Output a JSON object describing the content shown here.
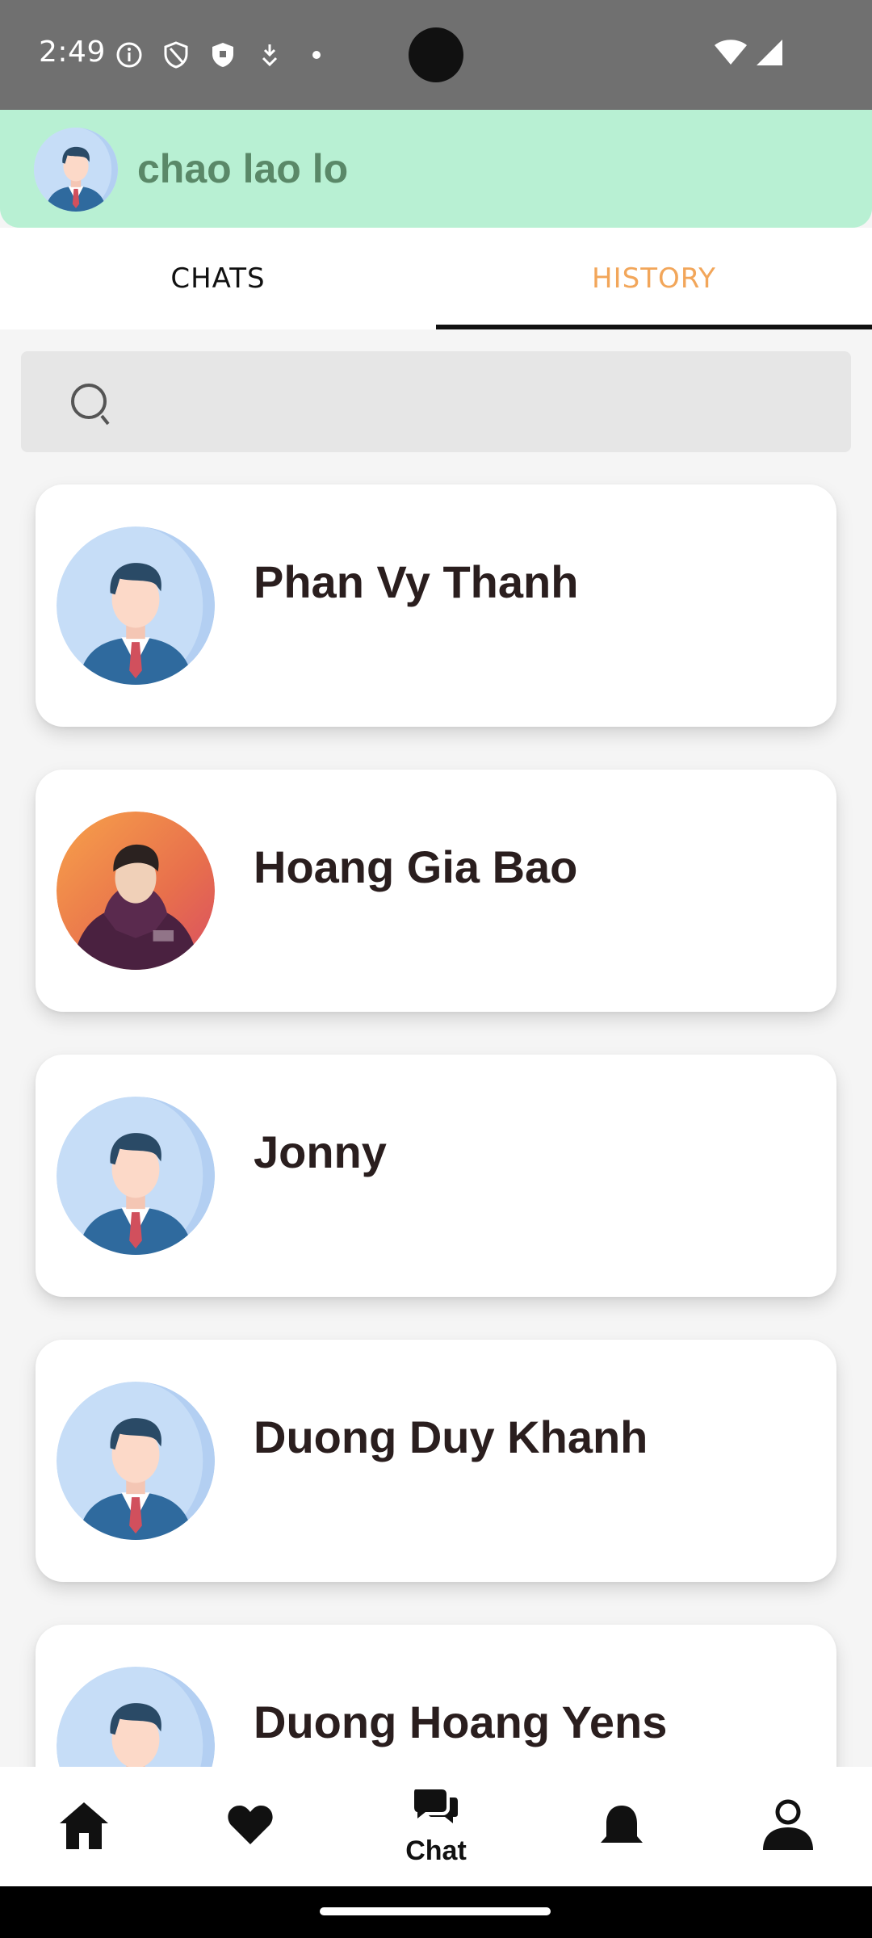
{
  "status_bar": {
    "time": "2:49",
    "left_icons": [
      "info-icon",
      "shield-outline-icon",
      "shield-filled-icon",
      "download-icon",
      "dot-icon"
    ],
    "right_icons": [
      "wifi-icon",
      "signal-icon"
    ]
  },
  "header": {
    "user_name": "chao lao lo",
    "background_color": "#b8f0d3"
  },
  "tabs": [
    {
      "label": "CHATS",
      "active": false
    },
    {
      "label": "HISTORY",
      "active": true
    }
  ],
  "search": {
    "placeholder": "",
    "value": ""
  },
  "contacts": [
    {
      "name": "Phan Vy Thanh",
      "avatar": "default-avatar"
    },
    {
      "name": "Hoang Gia Bao",
      "avatar": "photo-avatar"
    },
    {
      "name": "Jonny",
      "avatar": "default-avatar"
    },
    {
      "name": "Duong Duy Khanh",
      "avatar": "default-avatar"
    },
    {
      "name": "Duong Hoang Yens",
      "avatar": "default-avatar"
    }
  ],
  "bottom_nav": {
    "items": [
      {
        "icon": "home-icon",
        "label": ""
      },
      {
        "icon": "heart-icon",
        "label": ""
      },
      {
        "icon": "chat-icon",
        "label": "Chat"
      },
      {
        "icon": "bell-icon",
        "label": ""
      },
      {
        "icon": "person-icon",
        "label": ""
      }
    ]
  },
  "colors": {
    "accent_tab": "#f2a65a",
    "status_bar": "#707070",
    "name_text": "#2a1e1e"
  }
}
